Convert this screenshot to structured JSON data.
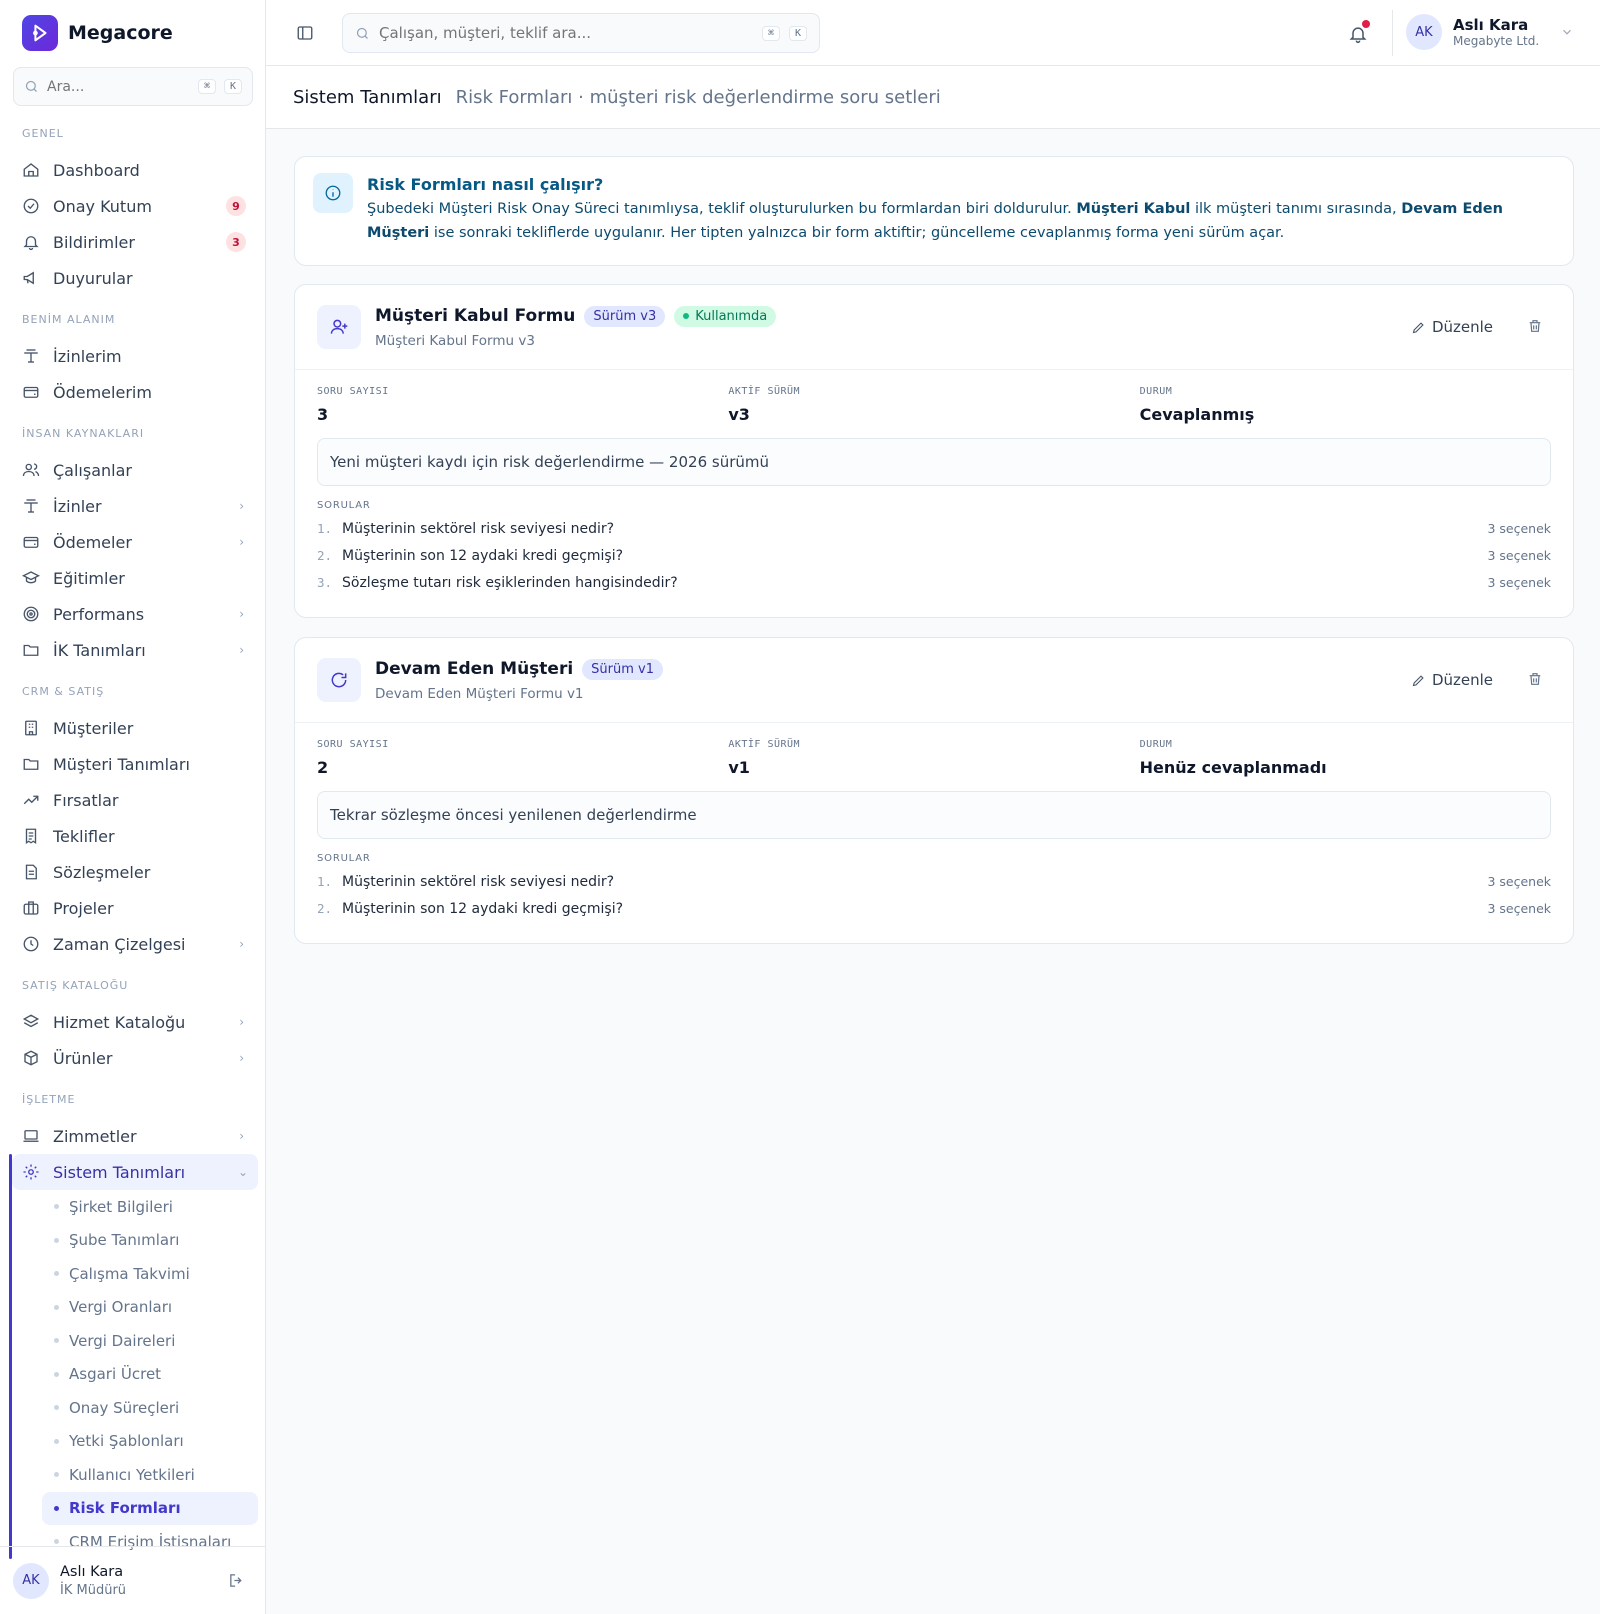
{
  "brand": {
    "name": "Megacore"
  },
  "sidebar": {
    "search_placeholder": "Ara...",
    "kbd1": "⌘",
    "kbd2": "K",
    "sections": {
      "genel": "GENEL",
      "benim": "BENİM ALANIM",
      "ik": "İNSAN KAYNAKLARI",
      "crm": "CRM & SATIŞ",
      "katalog": "SATIŞ KATALOĞU",
      "isletme": "İŞLETME"
    },
    "items": {
      "dashboard": "Dashboard",
      "onay": "Onay Kutum",
      "onay_badge": "9",
      "bildirimler": "Bildirimler",
      "bildirimler_badge": "3",
      "duyurular": "Duyurular",
      "izinlerim": "İzinlerim",
      "odemelerim": "Ödemelerim",
      "calisanlar": "Çalışanlar",
      "izinler": "İzinler",
      "odemeler": "Ödemeler",
      "egitimler": "Eğitimler",
      "performans": "Performans",
      "ik_tanimlari": "İK Tanımları",
      "musteriler": "Müşteriler",
      "musteri_tanimlari": "Müşteri Tanımları",
      "firsatlar": "Fırsatlar",
      "teklifler": "Teklifler",
      "sozlesmeler": "Sözleşmeler",
      "projeler": "Projeler",
      "zaman": "Zaman Çizelgesi",
      "hizmet": "Hizmet Kataloğu",
      "urunler": "Ürünler",
      "zimmetler": "Zimmetler",
      "sistem": "Sistem Tanımları"
    },
    "sub": [
      "Şirket Bilgileri",
      "Şube Tanımları",
      "Çalışma Takvimi",
      "Vergi Oranları",
      "Vergi Daireleri",
      "Asgari Ücret",
      "Onay Süreçleri",
      "Yetki Şablonları",
      "Kullanıcı Yetkileri",
      "Risk Formları",
      "CRM Erişim İstisnaları"
    ],
    "footer": {
      "initials": "AK",
      "name": "Aslı Kara",
      "role": "İK Müdürü"
    }
  },
  "topbar": {
    "search_placeholder": "Çalışan, müşteri, teklif ara...",
    "kbd1": "⌘",
    "kbd2": "K",
    "user_initials": "AK",
    "user_name": "Aslı Kara",
    "user_company": "Megabyte Ltd."
  },
  "page": {
    "title": "Sistem Tanımları",
    "subtitle": "Risk Formları · müşteri risk değerlendirme soru setleri"
  },
  "info": {
    "title": "Risk Formları nasıl çalışır?",
    "t1": "Şubedeki Müşteri Risk Onay Süreci tanımlıysa, teklif oluşturulurken bu formlardan biri doldurulur. ",
    "b1": "Müşteri Kabul",
    "t2": " ilk müşteri tanımı sırasında, ",
    "b2": "Devam Eden Müşteri",
    "t3": " ise sonraki tekliflerde uygulanır. Her tipten yalnızca bir form aktiftir; güncelleme cevaplanmış forma yeni sürüm açar."
  },
  "labels": {
    "edit": "Düzenle",
    "soru_sayisi": "SORU SAYISI",
    "aktif_surum": "AKTİF SÜRÜM",
    "durum": "DURUM",
    "sorular": "SORULAR"
  },
  "forms": [
    {
      "name": "Müşteri Kabul Formu",
      "version_pill": "Sürüm v3",
      "status_pill": "Kullanımda",
      "sub": "Müşteri Kabul Formu v3",
      "question_count": "3",
      "active_version": "v3",
      "status": "Cevaplanmış",
      "description": "Yeni müşteri kaydı için risk değerlendirme — 2026 sürümü",
      "questions": [
        {
          "n": "1.",
          "text": "Müşterinin sektörel risk seviyesi nedir?",
          "opts": "3 seçenek"
        },
        {
          "n": "2.",
          "text": "Müşterinin son 12 aydaki kredi geçmişi?",
          "opts": "3 seçenek"
        },
        {
          "n": "3.",
          "text": "Sözleşme tutarı risk eşiklerinden hangisindedir?",
          "opts": "3 seçenek"
        }
      ]
    },
    {
      "name": "Devam Eden Müşteri",
      "version_pill": "Sürüm v1",
      "sub": "Devam Eden Müşteri Formu v1",
      "question_count": "2",
      "active_version": "v1",
      "status": "Henüz cevaplanmadı",
      "description": "Tekrar sözleşme öncesi yenilenen değerlendirme",
      "questions": [
        {
          "n": "1.",
          "text": "Müşterinin sektörel risk seviyesi nedir?",
          "opts": "3 seçenek"
        },
        {
          "n": "2.",
          "text": "Müşterinin son 12 aydaki kredi geçmişi?",
          "opts": "3 seçenek"
        }
      ]
    }
  ],
  "colors": {
    "accent": "#4338ca",
    "info_bg": "#e0f2fe",
    "success": "#10b981",
    "danger": "#e11d48"
  }
}
